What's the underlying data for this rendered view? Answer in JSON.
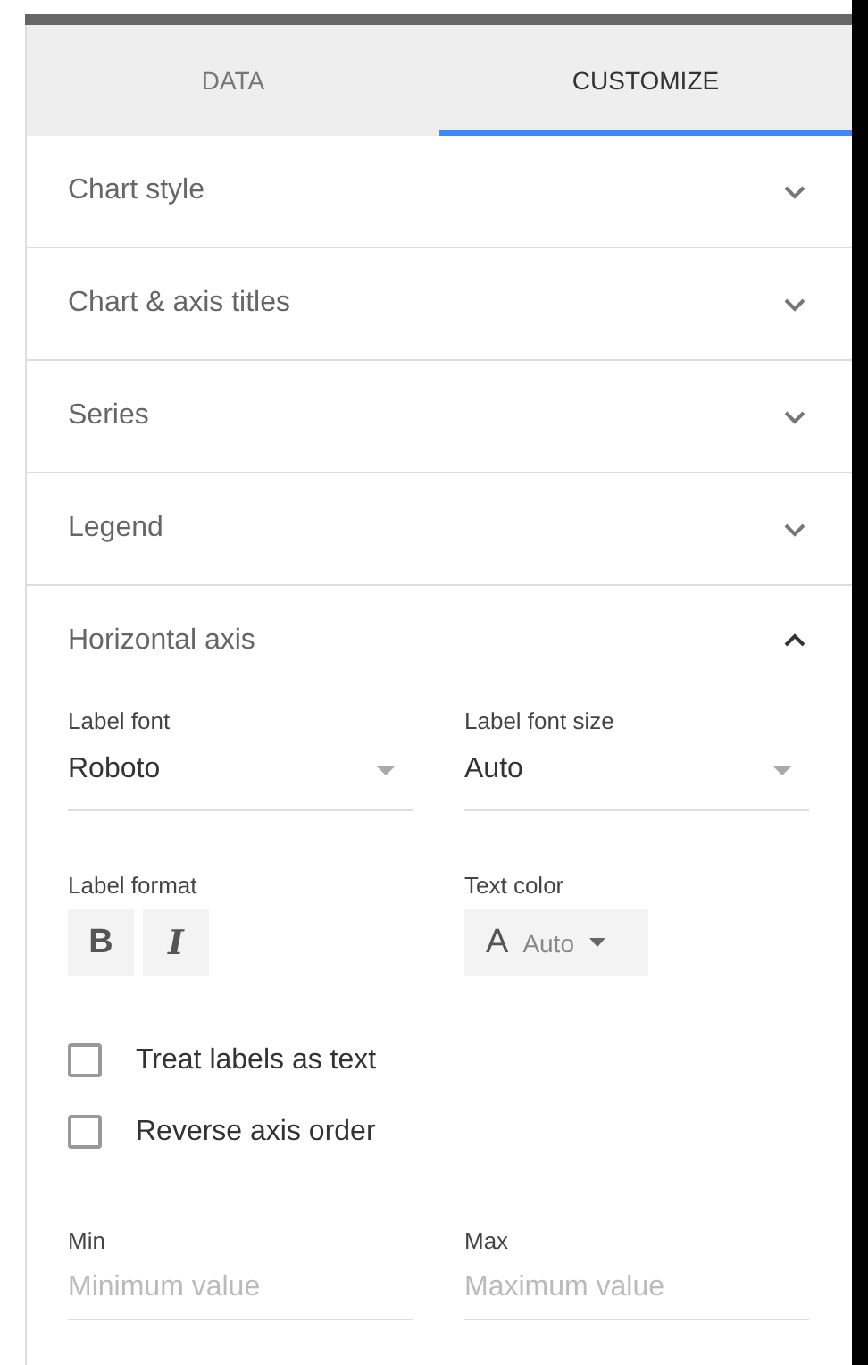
{
  "tabs": [
    {
      "label": "DATA",
      "selected": false
    },
    {
      "label": "CUSTOMIZE",
      "selected": true
    }
  ],
  "sections": [
    {
      "title": "Chart style",
      "expanded": false
    },
    {
      "title": "Chart & axis titles",
      "expanded": false
    },
    {
      "title": "Series",
      "expanded": false
    },
    {
      "title": "Legend",
      "expanded": false
    },
    {
      "title": "Horizontal axis",
      "expanded": true
    }
  ],
  "axis_settings": {
    "dropdowns": [
      {
        "label": "Label font",
        "value": "Roboto"
      },
      {
        "label": "Label font size",
        "value": "Auto"
      }
    ],
    "label_format": {
      "label": "Label format",
      "buttons": [
        {
          "text": "B",
          "kind": "bold",
          "selected": false
        },
        {
          "text": "I",
          "kind": "italic",
          "selected": false
        }
      ]
    },
    "text_color": {
      "label": "Text color",
      "glyph": "A",
      "value": "Auto"
    },
    "checkboxes": [
      {
        "label": "Treat labels as text",
        "checked": false
      },
      {
        "label": "Reverse axis order",
        "checked": false
      }
    ],
    "inputs": [
      {
        "label": "Min",
        "placeholder": "Minimum value"
      },
      {
        "label": "Max",
        "placeholder": "Maximum value"
      }
    ]
  }
}
